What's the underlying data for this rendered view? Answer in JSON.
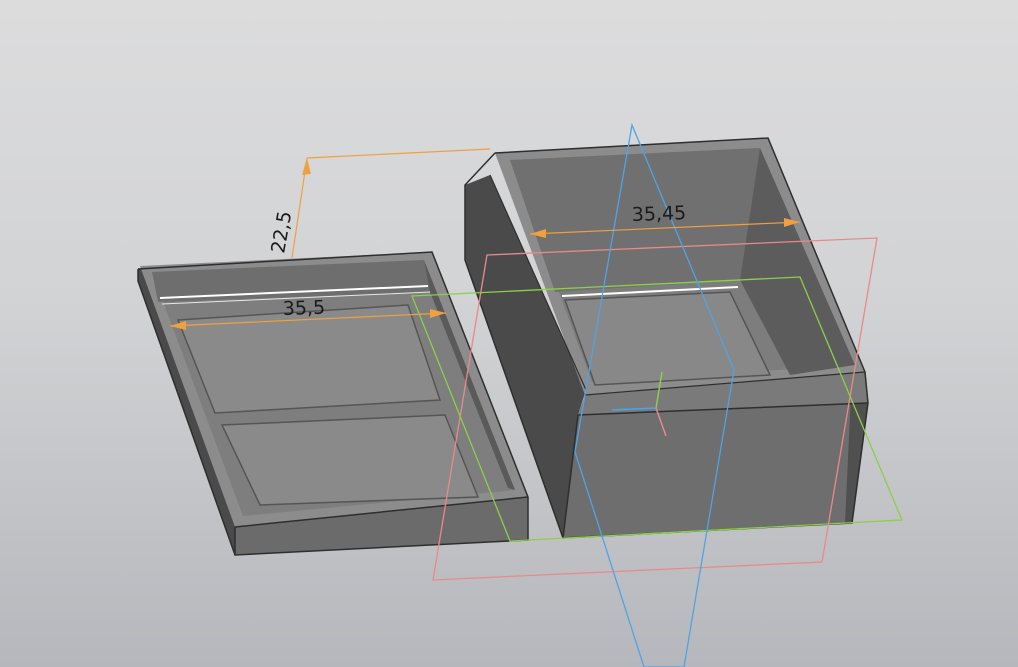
{
  "viewport": {
    "background_top": "#dcdcdd",
    "background_bottom": "#b6b7bc"
  },
  "colors": {
    "body_dark": "#4a4a4a",
    "body_mid": "#6e6e6e",
    "body_light": "#8a8a8a",
    "dimension_orange": "#f0a040",
    "plane_red": "#e88a8a",
    "plane_green": "#8ad048",
    "plane_blue": "#4fa3e6",
    "selection_highlight": "#ffffff"
  },
  "dimensions": {
    "height_label": "22,5",
    "lid_width_label": "35,5",
    "box_width_label": "35,45"
  },
  "icons": {
    "origin": "coordinate-origin-icon"
  }
}
